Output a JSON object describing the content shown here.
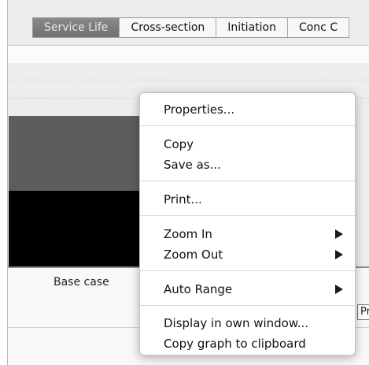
{
  "tabs": [
    "Service Life",
    "Cross-section",
    "Initiation",
    "Conc C"
  ],
  "active_tab_index": 0,
  "chart": {
    "category_label": "Base case",
    "legend_text": "Pro"
  },
  "context_menu": {
    "properties": "Properties...",
    "copy": "Copy",
    "save_as": "Save as...",
    "print": "Print...",
    "zoom_in": "Zoom In",
    "zoom_out": "Zoom Out",
    "auto_range": "Auto Range",
    "display_own_window": "Display in own window...",
    "copy_graph_clipboard": "Copy graph to clipboard"
  },
  "icons": {
    "submenu": "submenu-arrow-icon"
  },
  "colors": {
    "active_tab": "#7d7d7d",
    "bar_mid": "#5d5d5d",
    "bar_dark": "#000000",
    "chart_bg": "#ededed",
    "menu_bg": "#ffffff"
  }
}
